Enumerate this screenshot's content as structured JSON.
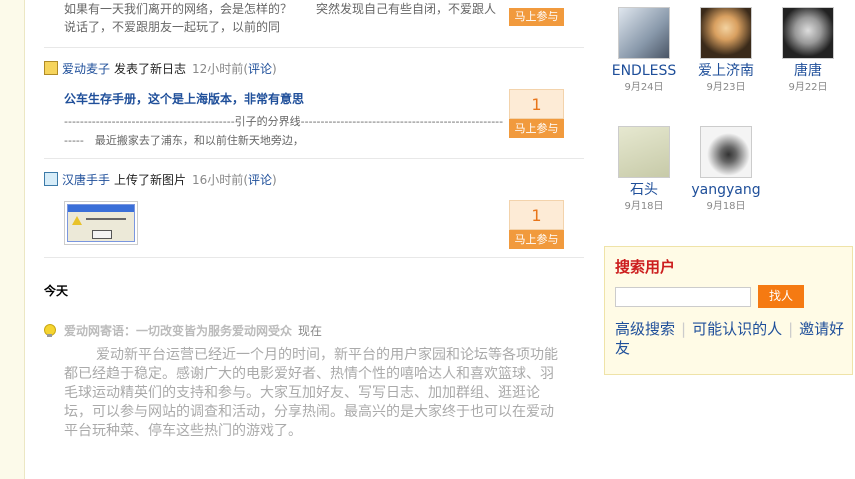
{
  "feed": {
    "top_partial": {
      "text": "如果有一天我们离开的网络，会是怎样的？　　突然发现自己有些自闭，不爱跟人说话了，不爱跟朋友一起玩了，以前的同",
      "vote_label": "马上参与"
    },
    "items": [
      {
        "user": "爱动麦子",
        "action": "发表了新日志",
        "time": "12小时前",
        "comment_label": "评论",
        "title": "公车生存手册，这个是上海版本，非常有意思",
        "excerpt": "-------------------------------------------引子的分界线--------------------------------------------------------　最近搬家去了浦东，和以前住新天地旁边，",
        "vote_count": "1",
        "vote_label": "马上参与"
      },
      {
        "user": "汉唐手手",
        "action": "上传了新图片",
        "time": "16小时前",
        "comment_label": "评论",
        "vote_count": "1",
        "vote_label": "马上参与"
      }
    ],
    "today_label": "今天",
    "notice": {
      "title": "爱动网寄语：一切改变皆为服务爱动网受众",
      "time": "现在",
      "body": "爱动新平台运营已经近一个月的时间，新平台的用户家园和论坛等各项功能都已经趋于稳定。感谢广大的电影爱好者、热情个性的嘻哈达人和喜欢篮球、羽毛球运动精英们的支持和参与。大家互加好友、写写日志、加加群组、逛逛论坛，可以参与网站的调查和活动，分享热闹。最高兴的是大家终于也可以在爱动平台玩种菜、停车这些热门的游戏了。"
    }
  },
  "friends": [
    {
      "name": "ENDLESS",
      "date": "9月24日"
    },
    {
      "name": "爱上济南",
      "date": "9月23日"
    },
    {
      "name": "唐唐",
      "date": "9月22日"
    },
    {
      "name": "石头",
      "date": "9月18日"
    },
    {
      "name": "yangyang",
      "date": "9月18日"
    }
  ],
  "search": {
    "title": "搜索用户",
    "input_value": "",
    "button": "找人",
    "links": [
      "高级搜索",
      "可能认识的人",
      "邀请好友"
    ]
  }
}
